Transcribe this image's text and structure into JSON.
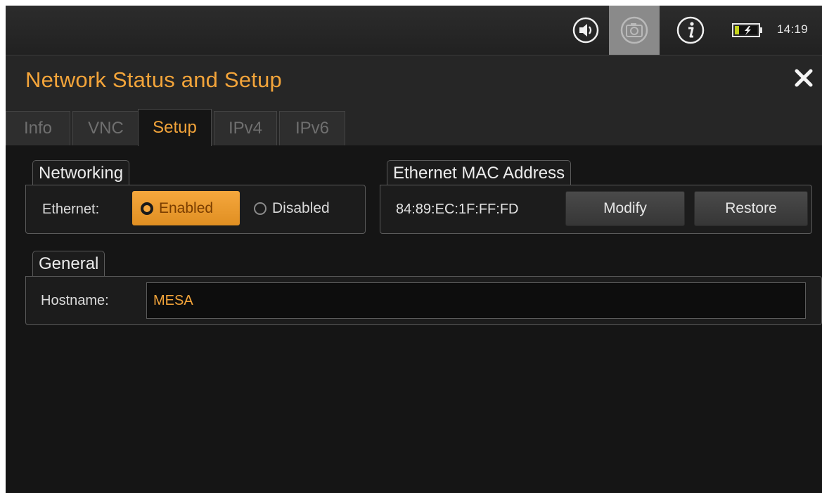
{
  "status_bar": {
    "time": "14:19",
    "icons": [
      "volume-icon",
      "camera-icon",
      "info-icon",
      "battery-charging-icon"
    ]
  },
  "header": {
    "title": "Network Status and Setup",
    "close_icon": "close-icon"
  },
  "tabs": [
    {
      "label": "Info",
      "active": false
    },
    {
      "label": "VNC",
      "active": false
    },
    {
      "label": "Setup",
      "active": true
    },
    {
      "label": "IPv4",
      "active": false
    },
    {
      "label": "IPv6",
      "active": false
    }
  ],
  "networking": {
    "group_title": "Networking",
    "ethernet_label": "Ethernet:",
    "options": [
      {
        "label": "Enabled",
        "selected": true
      },
      {
        "label": "Disabled",
        "selected": false
      }
    ]
  },
  "mac": {
    "group_title": "Ethernet MAC Address",
    "value": "84:89:EC:1F:FF:FD",
    "modify_label": "Modify",
    "restore_label": "Restore"
  },
  "general": {
    "group_title": "General",
    "hostname_label": "Hostname:",
    "hostname_value": "MESA"
  },
  "colors": {
    "accent": "#f3a43a",
    "background": "#151515",
    "panel": "#1c1c1c"
  }
}
